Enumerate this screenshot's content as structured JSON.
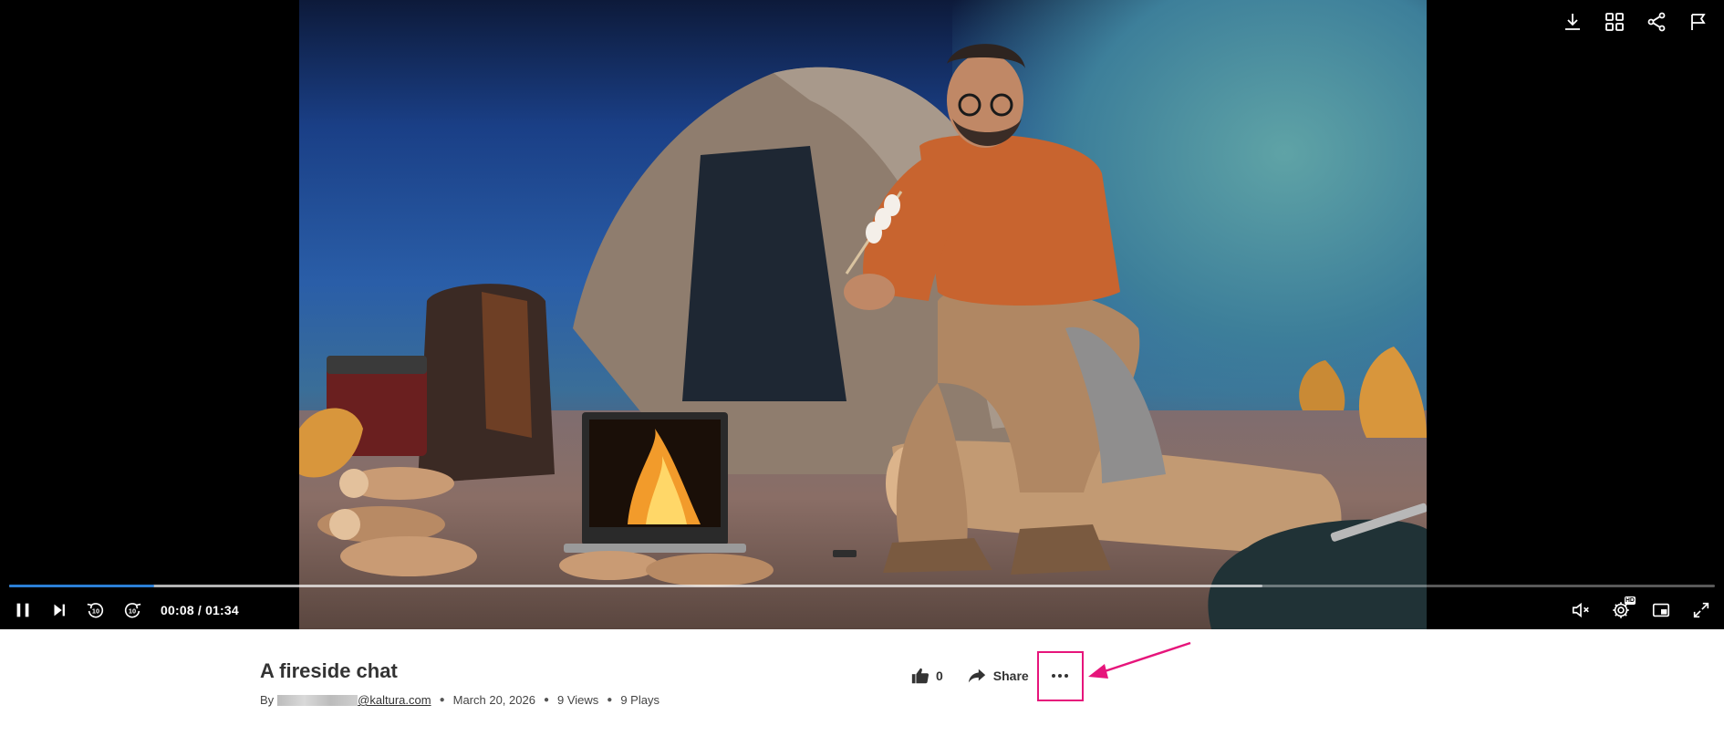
{
  "player": {
    "top_controls": [
      {
        "name": "download-icon"
      },
      {
        "name": "grid-icon"
      },
      {
        "name": "share-icon"
      },
      {
        "name": "flag-icon"
      }
    ],
    "progress": {
      "played_fraction": 0.085,
      "buffered_fraction": 0.735
    },
    "time_display": "00:08 / 01:34",
    "rewind_label": "10",
    "forward_label": "10",
    "hd_badge": "HD"
  },
  "media": {
    "title": "A fireside chat",
    "by_label": "By",
    "author_email_domain": "@kaltura.com",
    "date": "March 20, 2026",
    "views": "9 Views",
    "plays": "9 Plays"
  },
  "actions": {
    "like_count": "0",
    "share_label": "Share"
  },
  "colors": {
    "accent_blue": "#2b7fd6",
    "highlight_pink": "#e6157b"
  }
}
